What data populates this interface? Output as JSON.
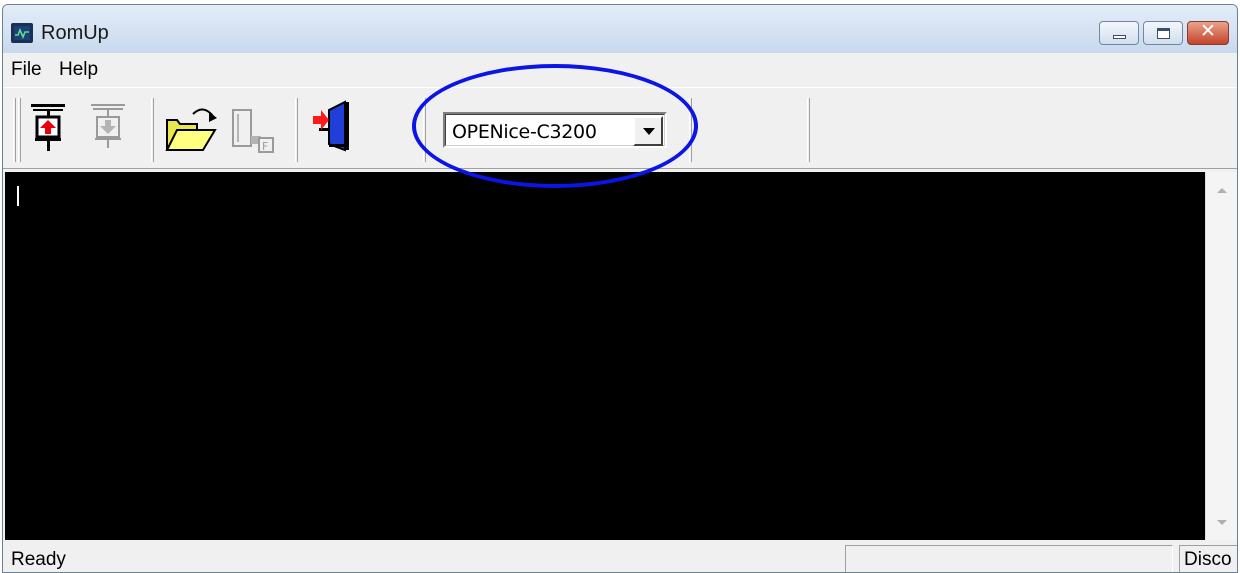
{
  "window": {
    "title": "RomUp",
    "app_icon": "oscilloscope-icon",
    "controls": [
      "minimize-icon",
      "maximize-icon",
      "close-icon"
    ],
    "close_glyph": "✕"
  },
  "menu": {
    "items": [
      {
        "label": "File"
      },
      {
        "label": "Help"
      }
    ]
  },
  "toolbar": {
    "buttons": [
      {
        "icon": "upload-to-chip-icon",
        "enabled": true
      },
      {
        "icon": "download-from-chip-icon",
        "enabled": false
      },
      {
        "icon": "open-folder-icon",
        "enabled": true
      },
      {
        "icon": "flash-file-icon",
        "enabled": false
      },
      {
        "icon": "exit-door-icon",
        "enabled": true
      }
    ],
    "device_select": {
      "value": "OPENice-C3200"
    }
  },
  "annotation": {
    "shape": "ellipse",
    "color": "#0a15e6"
  },
  "console": {
    "text": "",
    "background": "#000000"
  },
  "status": {
    "text": "Ready",
    "right_pane": "Disco"
  }
}
